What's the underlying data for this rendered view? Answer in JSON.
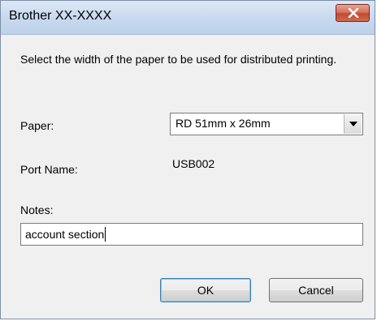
{
  "window": {
    "title": "Brother XX-XXXX"
  },
  "dialog": {
    "instruction": "Select the width of the paper to be used for distributed printing.",
    "paper_label": "Paper:",
    "paper_value": "RD  51mm x 26mm",
    "port_label": "Port Name:",
    "port_value": "USB002",
    "notes_label": "Notes:",
    "notes_value": "account section"
  },
  "buttons": {
    "ok_label": "OK",
    "cancel_label": "Cancel"
  },
  "icons": {
    "close": "close-icon",
    "dropdown": "chevron-down-icon"
  },
  "colors": {
    "close_button": "#c24a31",
    "titlebar": "#c9daef",
    "default_button_border": "#3c7fb1"
  }
}
